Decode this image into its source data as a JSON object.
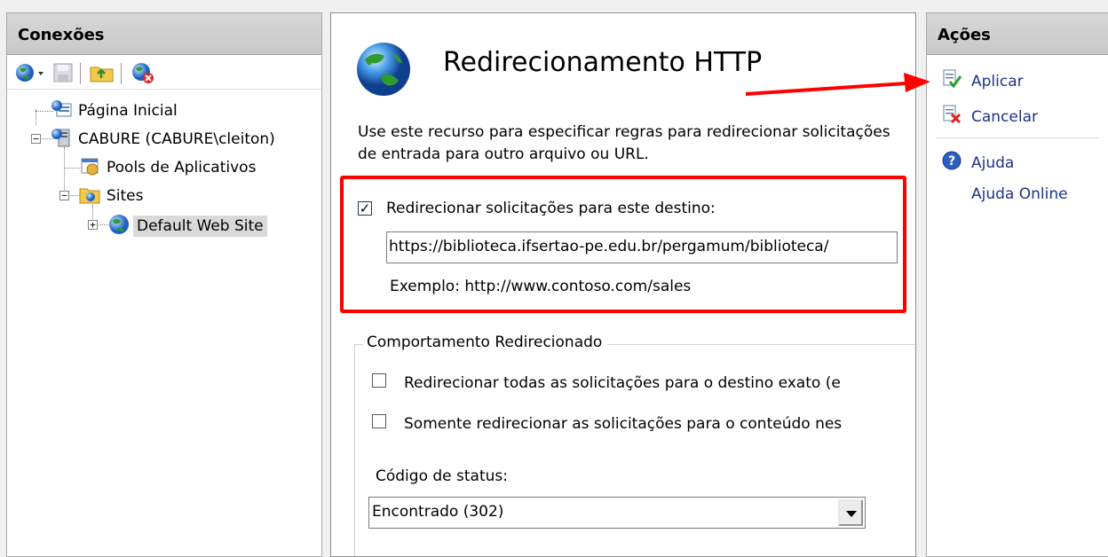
{
  "connections": {
    "title": "Conexões",
    "tree": {
      "start_page": "Página Inicial",
      "server": "CABURE (CABURE\\cleiton)",
      "app_pools": "Pools de Aplicativos",
      "sites": "Sites",
      "default_site": "Default Web Site"
    }
  },
  "feature": {
    "title": "Redirecionamento HTTP",
    "description": "Use este recurso para especificar regras para redirecionar solicitações de entrada para outro arquivo ou URL.",
    "redirect_checkbox_label": "Redirecionar solicitações para este destino:",
    "redirect_checked": true,
    "redirect_url": "https://biblioteca.ifsertao-pe.edu.br/pergamum/biblioteca/",
    "example": "Exemplo: http://www.contoso.com/sales",
    "behavior_group": "Comportamento Redirecionado",
    "option_exact": "Redirecionar todas as solicitações para o destino exato (e",
    "option_exact_checked": false,
    "option_content": "Somente redirecionar as solicitações para o conteúdo nes",
    "option_content_checked": false,
    "status_label": "Código de status:",
    "status_value": "Encontrado (302)"
  },
  "actions": {
    "title": "Ações",
    "apply": "Aplicar",
    "cancel": "Cancelar",
    "help": "Ajuda",
    "online_help": "Ajuda Online"
  },
  "colors": {
    "highlight_red": "#ff0000",
    "link_blue": "#1e3287",
    "header_gray": "#cfcfcf"
  },
  "icons": [
    "globe-icon",
    "save-icon",
    "folder-up-icon",
    "disconnect-icon",
    "start-page-icon",
    "server-icon",
    "app-pools-icon",
    "sites-folder-icon",
    "website-globe-icon",
    "apply-icon",
    "cancel-icon",
    "help-icon"
  ]
}
